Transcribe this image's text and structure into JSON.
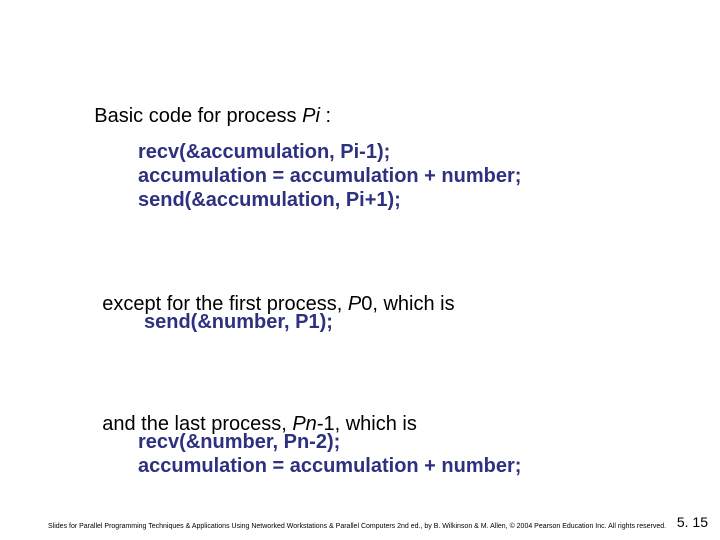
{
  "intro": {
    "prefix": "Basic code for process ",
    "var": "Pi",
    "suffix": " :"
  },
  "code1": {
    "l1": "recv(&accumulation, Pi-1);",
    "l2": "accumulation = accumulation + number;",
    "l3": "send(&accumulation, Pi+1);"
  },
  "mid1": {
    "prefix": "except for the first process, ",
    "var": "P",
    "num": "0, which is"
  },
  "code2": {
    "l1": "send(&number, P1);"
  },
  "mid2": {
    "prefix": "and the last process, ",
    "var": "Pn",
    "suffix": "-1, which is"
  },
  "code3": {
    "l1": "recv(&number, Pn-2);",
    "l2": "accumulation = accumulation + number;"
  },
  "footer": {
    "credit": "Slides for Parallel Programming Techniques & Applications Using Networked Workstations & Parallel Computers 2nd ed., by B. Wilkinson & M. Allen, © 2004 Pearson Education Inc. All rights reserved.",
    "page": "5. 15"
  }
}
